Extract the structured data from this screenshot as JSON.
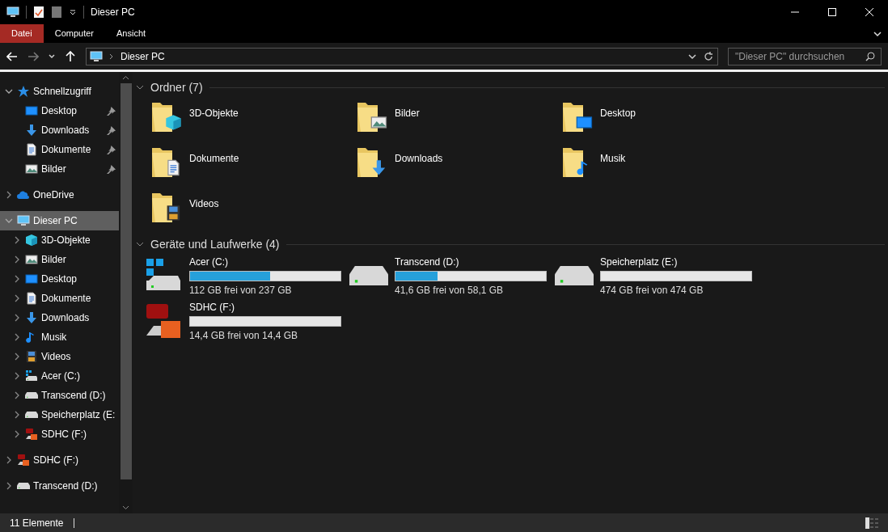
{
  "window": {
    "title": "Dieser PC"
  },
  "ribbon": {
    "tabs": [
      {
        "label": "Datei",
        "selected": true
      },
      {
        "label": "Computer",
        "selected": false
      },
      {
        "label": "Ansicht",
        "selected": false
      }
    ]
  },
  "address": {
    "path": "Dieser PC",
    "search_placeholder": "\"Dieser PC\" durchsuchen"
  },
  "sidebar": {
    "items": [
      {
        "label": "Schnellzugriff",
        "kind": "star",
        "expanded": true,
        "selected": false,
        "children": [
          {
            "label": "Desktop",
            "kind": "desktop",
            "selected": false,
            "pinned": true
          },
          {
            "label": "Downloads",
            "kind": "download",
            "selected": false,
            "pinned": true
          },
          {
            "label": "Dokumente",
            "kind": "document",
            "selected": false,
            "pinned": true
          },
          {
            "label": "Bilder",
            "kind": "pictures",
            "selected": false,
            "pinned": true
          }
        ]
      },
      {
        "label": "OneDrive",
        "kind": "cloud",
        "expanded": false,
        "selected": false
      },
      {
        "label": "Dieser PC",
        "kind": "pc",
        "expanded": true,
        "selected": true,
        "children": [
          {
            "label": "3D-Objekte",
            "kind": "cube",
            "expanded": false,
            "selected": false
          },
          {
            "label": "Bilder",
            "kind": "pictures",
            "expanded": false,
            "selected": false
          },
          {
            "label": "Desktop",
            "kind": "desktop",
            "expanded": false,
            "selected": false
          },
          {
            "label": "Dokumente",
            "kind": "document",
            "expanded": false,
            "selected": false
          },
          {
            "label": "Downloads",
            "kind": "download",
            "expanded": false,
            "selected": false
          },
          {
            "label": "Musik",
            "kind": "music",
            "expanded": false,
            "selected": false
          },
          {
            "label": "Videos",
            "kind": "video",
            "expanded": false,
            "selected": false
          },
          {
            "label": "Acer (C:)",
            "kind": "windrive",
            "expanded": false,
            "selected": false
          },
          {
            "label": "Transcend (D:)",
            "kind": "drive",
            "expanded": false,
            "selected": false
          },
          {
            "label": "Speicherplatz (E:",
            "kind": "drive",
            "expanded": false,
            "selected": false
          },
          {
            "label": "SDHC (F:)",
            "kind": "sd",
            "expanded": false,
            "selected": false
          }
        ]
      },
      {
        "label": "SDHC (F:)",
        "kind": "sd",
        "expanded": false,
        "selected": false
      },
      {
        "label": "Transcend (D:)",
        "kind": "drive",
        "expanded": false,
        "selected": false
      }
    ]
  },
  "folders": {
    "heading": "Ordner (7)",
    "items": [
      {
        "label": "3D-Objekte",
        "kind": "cube"
      },
      {
        "label": "Bilder",
        "kind": "pictures"
      },
      {
        "label": "Desktop",
        "kind": "desktop"
      },
      {
        "label": "Dokumente",
        "kind": "document"
      },
      {
        "label": "Downloads",
        "kind": "download"
      },
      {
        "label": "Musik",
        "kind": "music"
      },
      {
        "label": "Videos",
        "kind": "video"
      }
    ]
  },
  "drives": {
    "heading": "Geräte und Laufwerke (4)",
    "items": [
      {
        "label": "Acer (C:)",
        "kind": "windrive",
        "level": 0.53,
        "reading": "112 GB frei von 237 GB"
      },
      {
        "label": "Transcend (D:)",
        "kind": "drive",
        "level": 0.28,
        "reading": "41,6 GB frei von 58,1 GB"
      },
      {
        "label": "Speicherplatz (E:)",
        "kind": "drive",
        "level": 0,
        "reading": "474 GB frei von 474 GB"
      },
      {
        "label": "SDHC (F:)",
        "kind": "sd",
        "level": 0,
        "reading": "14,4 GB frei von 14,4 GB"
      }
    ]
  },
  "status_bar": {
    "count": "11 Elemente"
  }
}
